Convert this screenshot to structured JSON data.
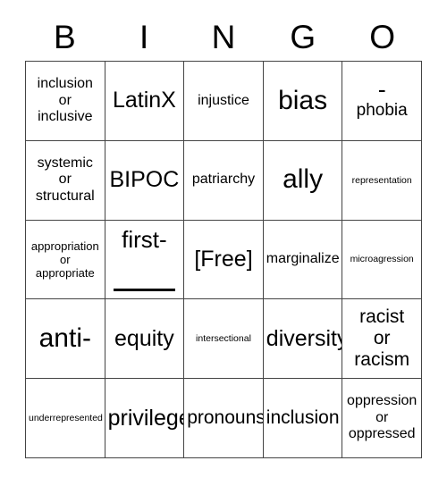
{
  "card": {
    "title": "BINGO",
    "header_letters": [
      "B",
      "I",
      "N",
      "G",
      "O"
    ],
    "free_space_label": "[Free]",
    "grid_size": "5x5",
    "border_color": "#444444",
    "text_color": "#000000",
    "background_color": "#ffffff",
    "rows": [
      [
        {
          "text": "inclusion\nor\ninclusive",
          "size": "md",
          "kind": "text"
        },
        {
          "text": "LatinX",
          "size": "xl",
          "kind": "text"
        },
        {
          "text": "injustice",
          "size": "md",
          "kind": "text"
        },
        {
          "text": "bias",
          "size": "xxl",
          "kind": "text"
        },
        {
          "text": "-phobia",
          "dash": "-",
          "word": "phobia",
          "size": "lg",
          "kind": "split-dash"
        }
      ],
      [
        {
          "text": "systemic\nor\nstructural",
          "size": "md",
          "kind": "text"
        },
        {
          "text": "BIPOC",
          "size": "xl",
          "kind": "text"
        },
        {
          "text": "patriarchy",
          "size": "md",
          "kind": "text"
        },
        {
          "text": "ally",
          "size": "xxl",
          "kind": "text"
        },
        {
          "text": "representation",
          "size": "xs",
          "kind": "text"
        }
      ],
      [
        {
          "text": "appropriation\nor\nappropriate",
          "size": "sm",
          "kind": "text"
        },
        {
          "text": "first-",
          "size": "xl",
          "kind": "fill-blank"
        },
        {
          "text": "[Free]",
          "size": "xl",
          "kind": "free"
        },
        {
          "text": "marginalize",
          "size": "md",
          "kind": "text"
        },
        {
          "text": "microagression",
          "size": "xs",
          "kind": "text"
        }
      ],
      [
        {
          "text": "anti-",
          "size": "xxl",
          "kind": "text"
        },
        {
          "text": "equity",
          "size": "xl",
          "kind": "text"
        },
        {
          "text": "intersectional",
          "size": "xs",
          "kind": "text"
        },
        {
          "text": "diversity",
          "size": "xl",
          "kind": "text"
        },
        {
          "text": "racist\nor\nracism",
          "size": "lg",
          "kind": "text"
        }
      ],
      [
        {
          "text": "underrepresented",
          "size": "xs",
          "kind": "text"
        },
        {
          "text": "privilege",
          "size": "xl",
          "kind": "text"
        },
        {
          "text": "pronouns",
          "size": "lg",
          "kind": "text"
        },
        {
          "text": "inclusion",
          "size": "lg",
          "kind": "text"
        },
        {
          "text": "oppression\nor\noppressed",
          "size": "md",
          "kind": "text"
        }
      ]
    ]
  }
}
